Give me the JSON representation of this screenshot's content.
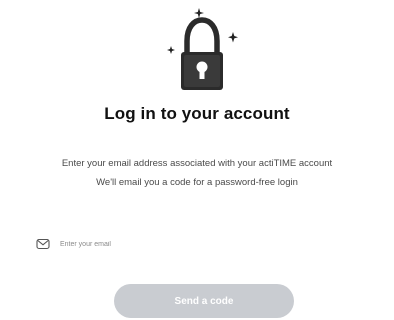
{
  "header": {
    "icon": "padlock-with-sparkles-icon",
    "title": "Log in to your account"
  },
  "description": {
    "line1": "Enter your email address associated with your actiTIME account",
    "line2": "We'll email you a code for a password-free login"
  },
  "email_field": {
    "icon": "envelope-icon",
    "placeholder": "Enter your email",
    "value": ""
  },
  "send_button": {
    "label": "Send a code",
    "state": "disabled"
  },
  "colors": {
    "background": "#ffffff",
    "lock": "#2b2b2b",
    "title_text": "#111111",
    "body_text": "#4a4a4a",
    "button_disabled": "#c9ccd1"
  }
}
